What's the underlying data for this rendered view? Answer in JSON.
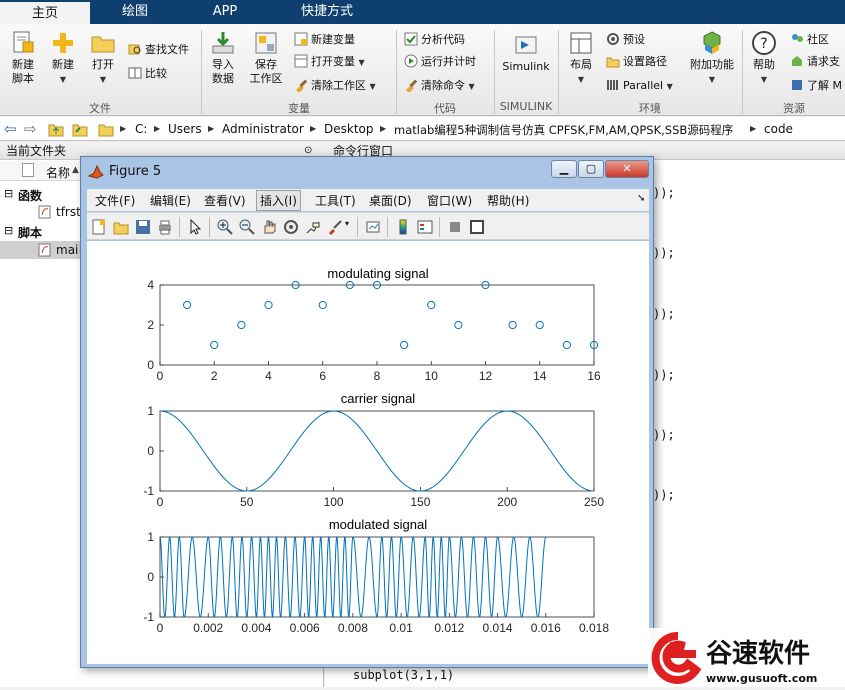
{
  "tabs": [
    {
      "label": "主页",
      "active": true
    },
    {
      "label": "绘图",
      "active": false
    },
    {
      "label": "APP",
      "active": false
    },
    {
      "label": "快捷方式",
      "active": false
    }
  ],
  "ribbon": {
    "file": {
      "new_script": "新建\n脚本",
      "new": "新建",
      "open": "打开",
      "find_files": "查找文件",
      "compare": "比较",
      "group": "文件"
    },
    "variable": {
      "import": "导入\n数据",
      "save_ws": "保存\n工作区",
      "new_var": "新建变量",
      "open_var": "打开变量",
      "clear_ws": "清除工作区",
      "group": "变量"
    },
    "code": {
      "analyze": "分析代码",
      "run_time": "运行并计时",
      "clear_cmd": "清除命令",
      "group": "代码"
    },
    "simulink": {
      "label": "Simulink",
      "group": "SIMULINK"
    },
    "env": {
      "layout": "布局",
      "preferences": "预设",
      "set_path": "设置路径",
      "parallel": "Parallel",
      "addons": "附加功能",
      "group": "环境"
    },
    "resources": {
      "help": "帮助",
      "community": "社区",
      "request": "请求支",
      "learn": "了解 M",
      "group": "资源"
    }
  },
  "address": {
    "crumbs": [
      "C:",
      "Users",
      "Administrator",
      "Desktop",
      "matlab编程5种调制信号仿真 CPFSK,FM,AM,QPSK,SSB源码程序",
      "code"
    ]
  },
  "file_panel": {
    "title": "当前文件夹",
    "column": "名称",
    "sort_arrow": "▲",
    "groups": [
      {
        "label": "函数",
        "items": [
          "tfrst"
        ]
      },
      {
        "label": "脚本",
        "items": [
          "mai"
        ]
      }
    ]
  },
  "command_window": {
    "title": "命令行窗口",
    "fragments": [
      "));",
      "));",
      "));",
      "));",
      "));",
      "));"
    ],
    "last_line": "subplot(3,1,1)"
  },
  "figure": {
    "title": "Figure 5",
    "menus": [
      "文件(F)",
      "编辑(E)",
      "查看(V)",
      "插入(I)",
      "工具(T)",
      "桌面(D)",
      "窗口(W)",
      "帮助(H)"
    ],
    "selected_menu_index": 3
  },
  "chart_data": [
    {
      "type": "scatter",
      "title": "modulating signal",
      "x": [
        1,
        2,
        3,
        4,
        5,
        6,
        7,
        8,
        9,
        10,
        11,
        12,
        13,
        14,
        15,
        16
      ],
      "y": [
        3,
        1,
        2,
        3,
        4,
        3,
        4,
        4,
        1,
        3,
        2,
        4,
        2,
        2,
        1,
        1
      ],
      "xlim": [
        0,
        16
      ],
      "ylim": [
        0,
        4
      ],
      "xticks": [
        0,
        2,
        4,
        6,
        8,
        10,
        12,
        14,
        16
      ],
      "yticks": [
        0,
        2,
        4
      ],
      "marker": "circle",
      "color": "#0072bd"
    },
    {
      "type": "line",
      "title": "carrier signal",
      "function": "cos(2*pi*n/100)",
      "xlim": [
        0,
        250
      ],
      "ylim": [
        -1,
        1
      ],
      "xticks": [
        0,
        50,
        100,
        150,
        200,
        250
      ],
      "yticks": [
        -1,
        0,
        1
      ],
      "samples": 201,
      "color": "#0072bd"
    },
    {
      "type": "line",
      "title": "modulated signal",
      "xlim": [
        0,
        0.018
      ],
      "ylim": [
        -1,
        1
      ],
      "xticks": [
        "0",
        "0.002",
        "0.004",
        "0.006",
        "0.008",
        "0.01",
        "0.012",
        "0.014",
        "0.016",
        "0.018"
      ],
      "yticks": [
        -1,
        0,
        1
      ],
      "signal_end": 0.016,
      "symbol_duration": 0.001,
      "symbols": [
        3,
        1,
        2,
        3,
        4,
        3,
        4,
        4,
        1,
        3,
        2,
        4,
        2,
        2,
        1,
        1
      ],
      "cycles_per_symbol": [
        1.5,
        2.0,
        2.5,
        3.0
      ],
      "color": "#0072bd"
    }
  ],
  "watermark": {
    "text": "谷速软件",
    "url": "www.gusuoft.com",
    "accent": "#e02020"
  },
  "colors": {
    "tabbar": "#0f3f6e",
    "plot_line": "#0072bd",
    "figure_frame": "#a9c4e4"
  }
}
